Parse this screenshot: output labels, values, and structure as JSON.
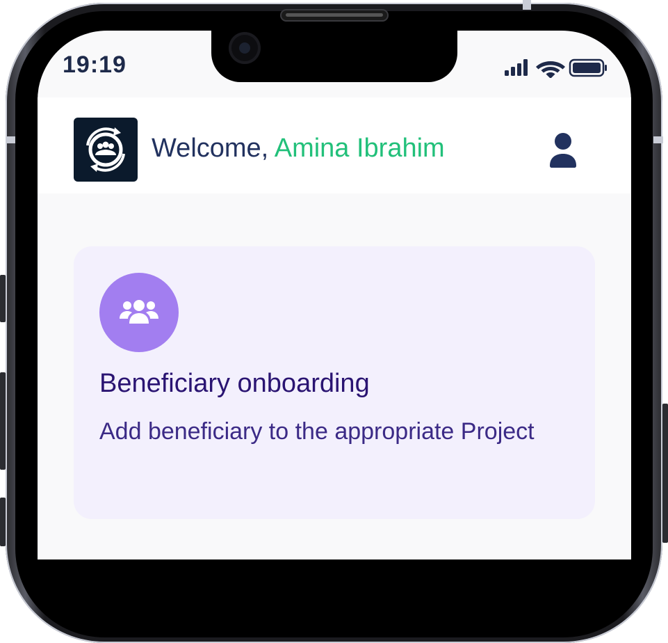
{
  "status_bar": {
    "time": "19:19",
    "icons": [
      "cellular-signal-icon",
      "wifi-icon",
      "battery-icon"
    ]
  },
  "header": {
    "welcome_prefix": "Welcome,",
    "user_name": "Amina Ibrahim",
    "logo_icon": "app-logo-icon",
    "profile_icon": "user-icon"
  },
  "card": {
    "icon": "users-group-icon",
    "title": "Beneficiary onboarding",
    "description": "Add beneficiary to the appropriate Project"
  },
  "colors": {
    "accent_green": "#22c07a",
    "navy": "#22325f",
    "card_bg": "#f3f0fd",
    "card_icon_bg": "#a27ef0",
    "card_title": "#2a1472",
    "logo_bg": "#0b1a2c"
  }
}
